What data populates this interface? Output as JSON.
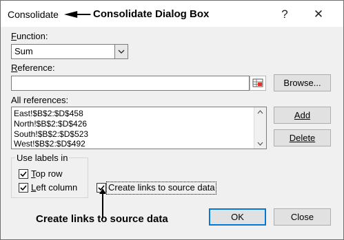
{
  "dialog": {
    "title": "Consolidate",
    "help_label": "?",
    "close_label": "✕"
  },
  "annotations": {
    "title_note": "Consolidate Dialog Box",
    "links_note": "Create links to source data"
  },
  "function": {
    "label_first": "F",
    "label_rest": "unction:",
    "value": "Sum"
  },
  "reference": {
    "label_first": "R",
    "label_rest": "eference:",
    "value": "",
    "browse_label": "Browse..."
  },
  "all_references": {
    "label": "All references:",
    "items": [
      "East!$B$2:$D$458",
      "North!$B$2:$D$426",
      "South!$B$2:$D$523",
      "West!$B$2:$D$492"
    ],
    "add_label": "Add",
    "delete_label": "Delete"
  },
  "use_labels": {
    "title": "Use labels in",
    "top_row": {
      "first": "T",
      "rest": "op row",
      "checked": true
    },
    "left_column": {
      "first": "L",
      "rest": "eft column",
      "checked": true
    }
  },
  "create_links": {
    "label": "Create links to source data",
    "checked": true
  },
  "footer": {
    "ok_label": "OK",
    "close_label": "Close"
  }
}
